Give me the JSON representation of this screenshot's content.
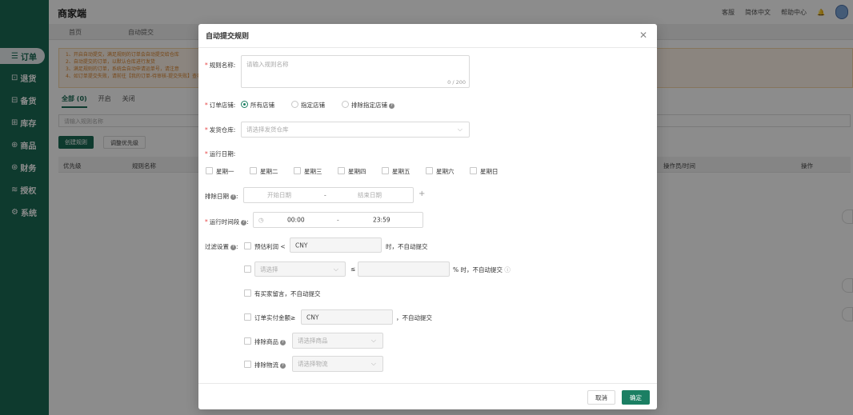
{
  "app": {
    "brand": "商家端",
    "top_links": [
      "客服",
      "简体中文",
      "帮助中心"
    ],
    "bell": "bell-icon"
  },
  "sidebar": {
    "items": [
      {
        "icon": "☰",
        "label": "订单"
      },
      {
        "icon": "⊡",
        "label": "退货"
      },
      {
        "icon": "⊟",
        "label": "备货"
      },
      {
        "icon": "⊞",
        "label": "库存"
      },
      {
        "icon": "⊕",
        "label": "商品"
      },
      {
        "icon": "⊛",
        "label": "财务"
      },
      {
        "icon": "≋",
        "label": "授权"
      },
      {
        "icon": "⚙",
        "label": "系统"
      }
    ]
  },
  "page_tabs": [
    "首页",
    "自动提交"
  ],
  "notice": [
    "1、开启自动提交，满足规则的订单会自动提交给仓库",
    "2、自动提交的订单，以默认仓库进行发货",
    "3、满足规则的订单，系统会自动申请运单号，请注意",
    "4、如订单提交失败，请前往【我的订单-待审核-提交失败】查看"
  ],
  "filter_tabs": [
    "全部 (0)",
    "开启",
    "关闭"
  ],
  "bg_search_placeholder": "请输入规则名称",
  "bg_buttons": {
    "create": "创建规则",
    "priority": "调整优先级"
  },
  "bg_table_headers": [
    "优先级",
    "规则名称",
    "操作员/时间",
    "操作"
  ],
  "modal": {
    "title": "自动提交规则",
    "rule_name": {
      "label": "规则名称:",
      "placeholder": "请输入规则名称",
      "counter": "0 / 200"
    },
    "store": {
      "label": "订单店铺:",
      "options": [
        "所有店铺",
        "指定店铺",
        "排除指定店铺"
      ],
      "selected": "所有店铺"
    },
    "warehouse": {
      "label": "发货仓库:",
      "placeholder": "请选择发货仓库"
    },
    "run_date": {
      "label": "运行日期:",
      "days": [
        "星期一",
        "星期二",
        "星期三",
        "星期四",
        "星期五",
        "星期六",
        "星期日"
      ]
    },
    "exclude_date": {
      "label": "排除日期",
      "start": "开始日期",
      "sep": "-",
      "end": "结束日期",
      "add": "+"
    },
    "run_time": {
      "label": "运行时间段",
      "start": "00:00",
      "sep": "-",
      "end": "23:59"
    },
    "filter": {
      "label": "过滤设置",
      "profit_label": "预估利润 <",
      "profit_currency": "CNY",
      "profit_suffix": "时，不自动提交",
      "select_placeholder": "请选择",
      "le": "≤",
      "pct_suffix": "% 时，不自动提交",
      "buyer_note": "有买家留言，不自动提交",
      "paid_label": "订单实付金额≥",
      "paid_currency": "CNY",
      "paid_suffix": "，不自动提交",
      "exclude_goods_label": "排除商品",
      "exclude_goods_placeholder": "请选择商品",
      "exclude_logistics_label": "排除物流",
      "exclude_logistics_placeholder": "请选择物流"
    },
    "footer": {
      "cancel": "取消",
      "ok": "确定"
    }
  }
}
